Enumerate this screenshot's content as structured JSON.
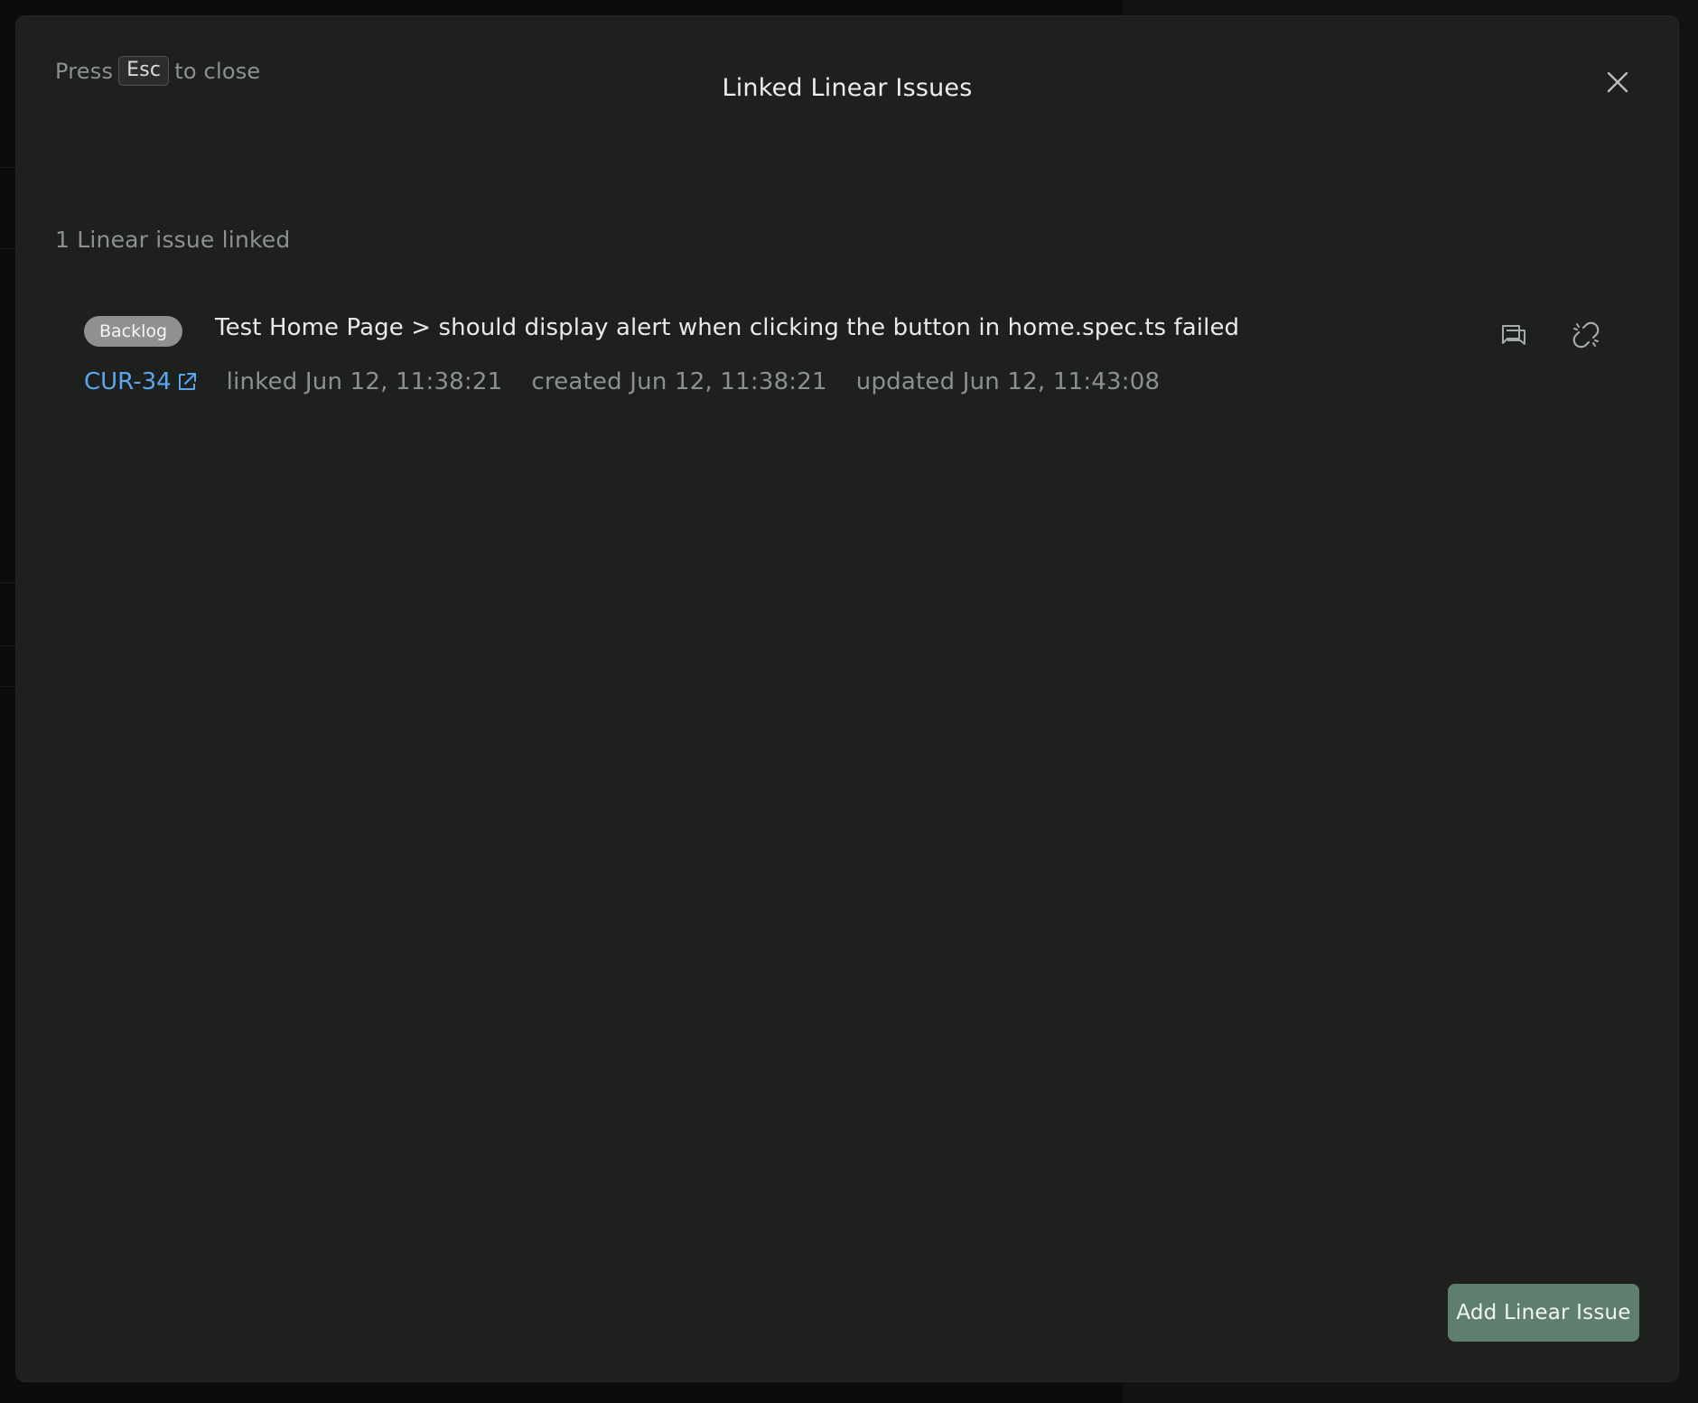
{
  "modal": {
    "esc_hint": {
      "before": "Press",
      "key": "Esc",
      "after": "to close"
    },
    "title": "Linked Linear Issues",
    "close_icon": "close-icon"
  },
  "issues_summary": "1 Linear issue linked",
  "issues": [
    {
      "status": "Backlog",
      "title": "Test Home Page > should display alert when clicking the button in home.spec.ts failed",
      "id": "CUR-34",
      "linked": "linked Jun 12, 11:38:21",
      "created": "created Jun 12, 11:38:21",
      "updated": "updated Jun 12, 11:43:08",
      "actions": [
        "comment-icon",
        "unlink-icon"
      ]
    }
  ],
  "footer": {
    "add_button_label": "Add Linear Issue"
  },
  "colors": {
    "accent_link": "#5aa7ef",
    "primary_button": "#5f7f6e",
    "badge_backlog": "#8e918f",
    "modal_bg": "#1e201e"
  }
}
